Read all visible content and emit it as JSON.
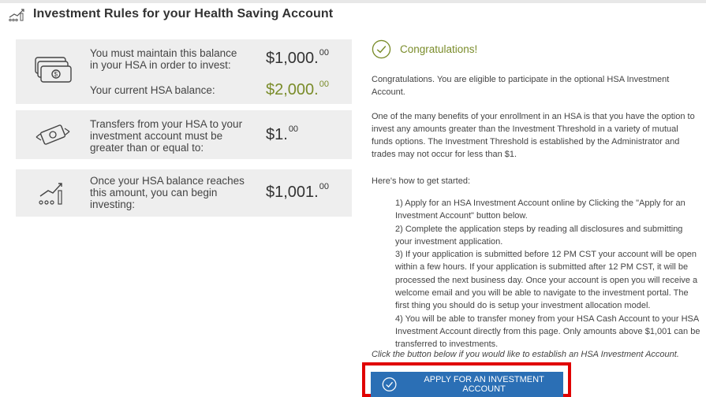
{
  "header": {
    "title": "Investment Rules for your Health Saving Account",
    "icon": "growth-chart-icon"
  },
  "cards": {
    "balance": {
      "requirement_text": "You must maintain this balance in your HSA in order to invest:",
      "requirement_amount": "$1,000.",
      "requirement_cents": "00",
      "current_label": "Your current HSA balance:",
      "current_amount": "$2,000.",
      "current_cents": "00",
      "icon": "cash-stack-icon"
    },
    "transfer": {
      "text": "Transfers from your HSA to your investment account must be greater than or equal to:",
      "amount": "$1.",
      "cents": "00",
      "icon": "money-transfer-icon"
    },
    "threshold": {
      "text": "Once your HSA balance reaches this amount, you can begin investing:",
      "amount": "$1,001.",
      "cents": "00",
      "icon": "growth-chart-icon"
    }
  },
  "congrats": {
    "title": "Congratulations!",
    "eligible": "Congratulations. You are eligible to participate in the optional HSA Investment Account.",
    "benefits": "One of the many benefits of your enrollment in an HSA is that you have the option to invest any amounts greater than the Investment Threshold in a variety of mutual funds options. The Investment Threshold is established by the Administrator and trades may not occur for less than $1.",
    "howto": "Here's how to get started:",
    "steps": [
      "1)  Apply for an HSA Investment Account online by Clicking the \"Apply for an Investment Account\" button below.",
      "2)  Complete the application steps by reading all disclosures and submitting your investment application.",
      "3)  If your application is submitted before 12 PM CST your account will be open within a few hours.  If your application is submitted after 12 PM CST, it will be processed the next business day.  Once your account is open you will receive a welcome email and you will be able to navigate to the investment portal.  The first thing you should do is setup your investment allocation model.",
      "4)  You will be able to transfer money from your HSA Cash Account to your HSA Investment Account directly from this page. Only amounts above $1,001 can be transferred to investments."
    ],
    "instruction": "Click the button below if you would like to establish an HSA Investment Account."
  },
  "apply_button": {
    "label": "APPLY FOR AN INVESTMENT ACCOUNT",
    "icon": "check-circle-icon"
  },
  "colors": {
    "accent_green": "#7a8c2a",
    "button_blue": "#2b6fb5",
    "highlight_red": "#e00000",
    "card_bg": "#eeeeee"
  }
}
